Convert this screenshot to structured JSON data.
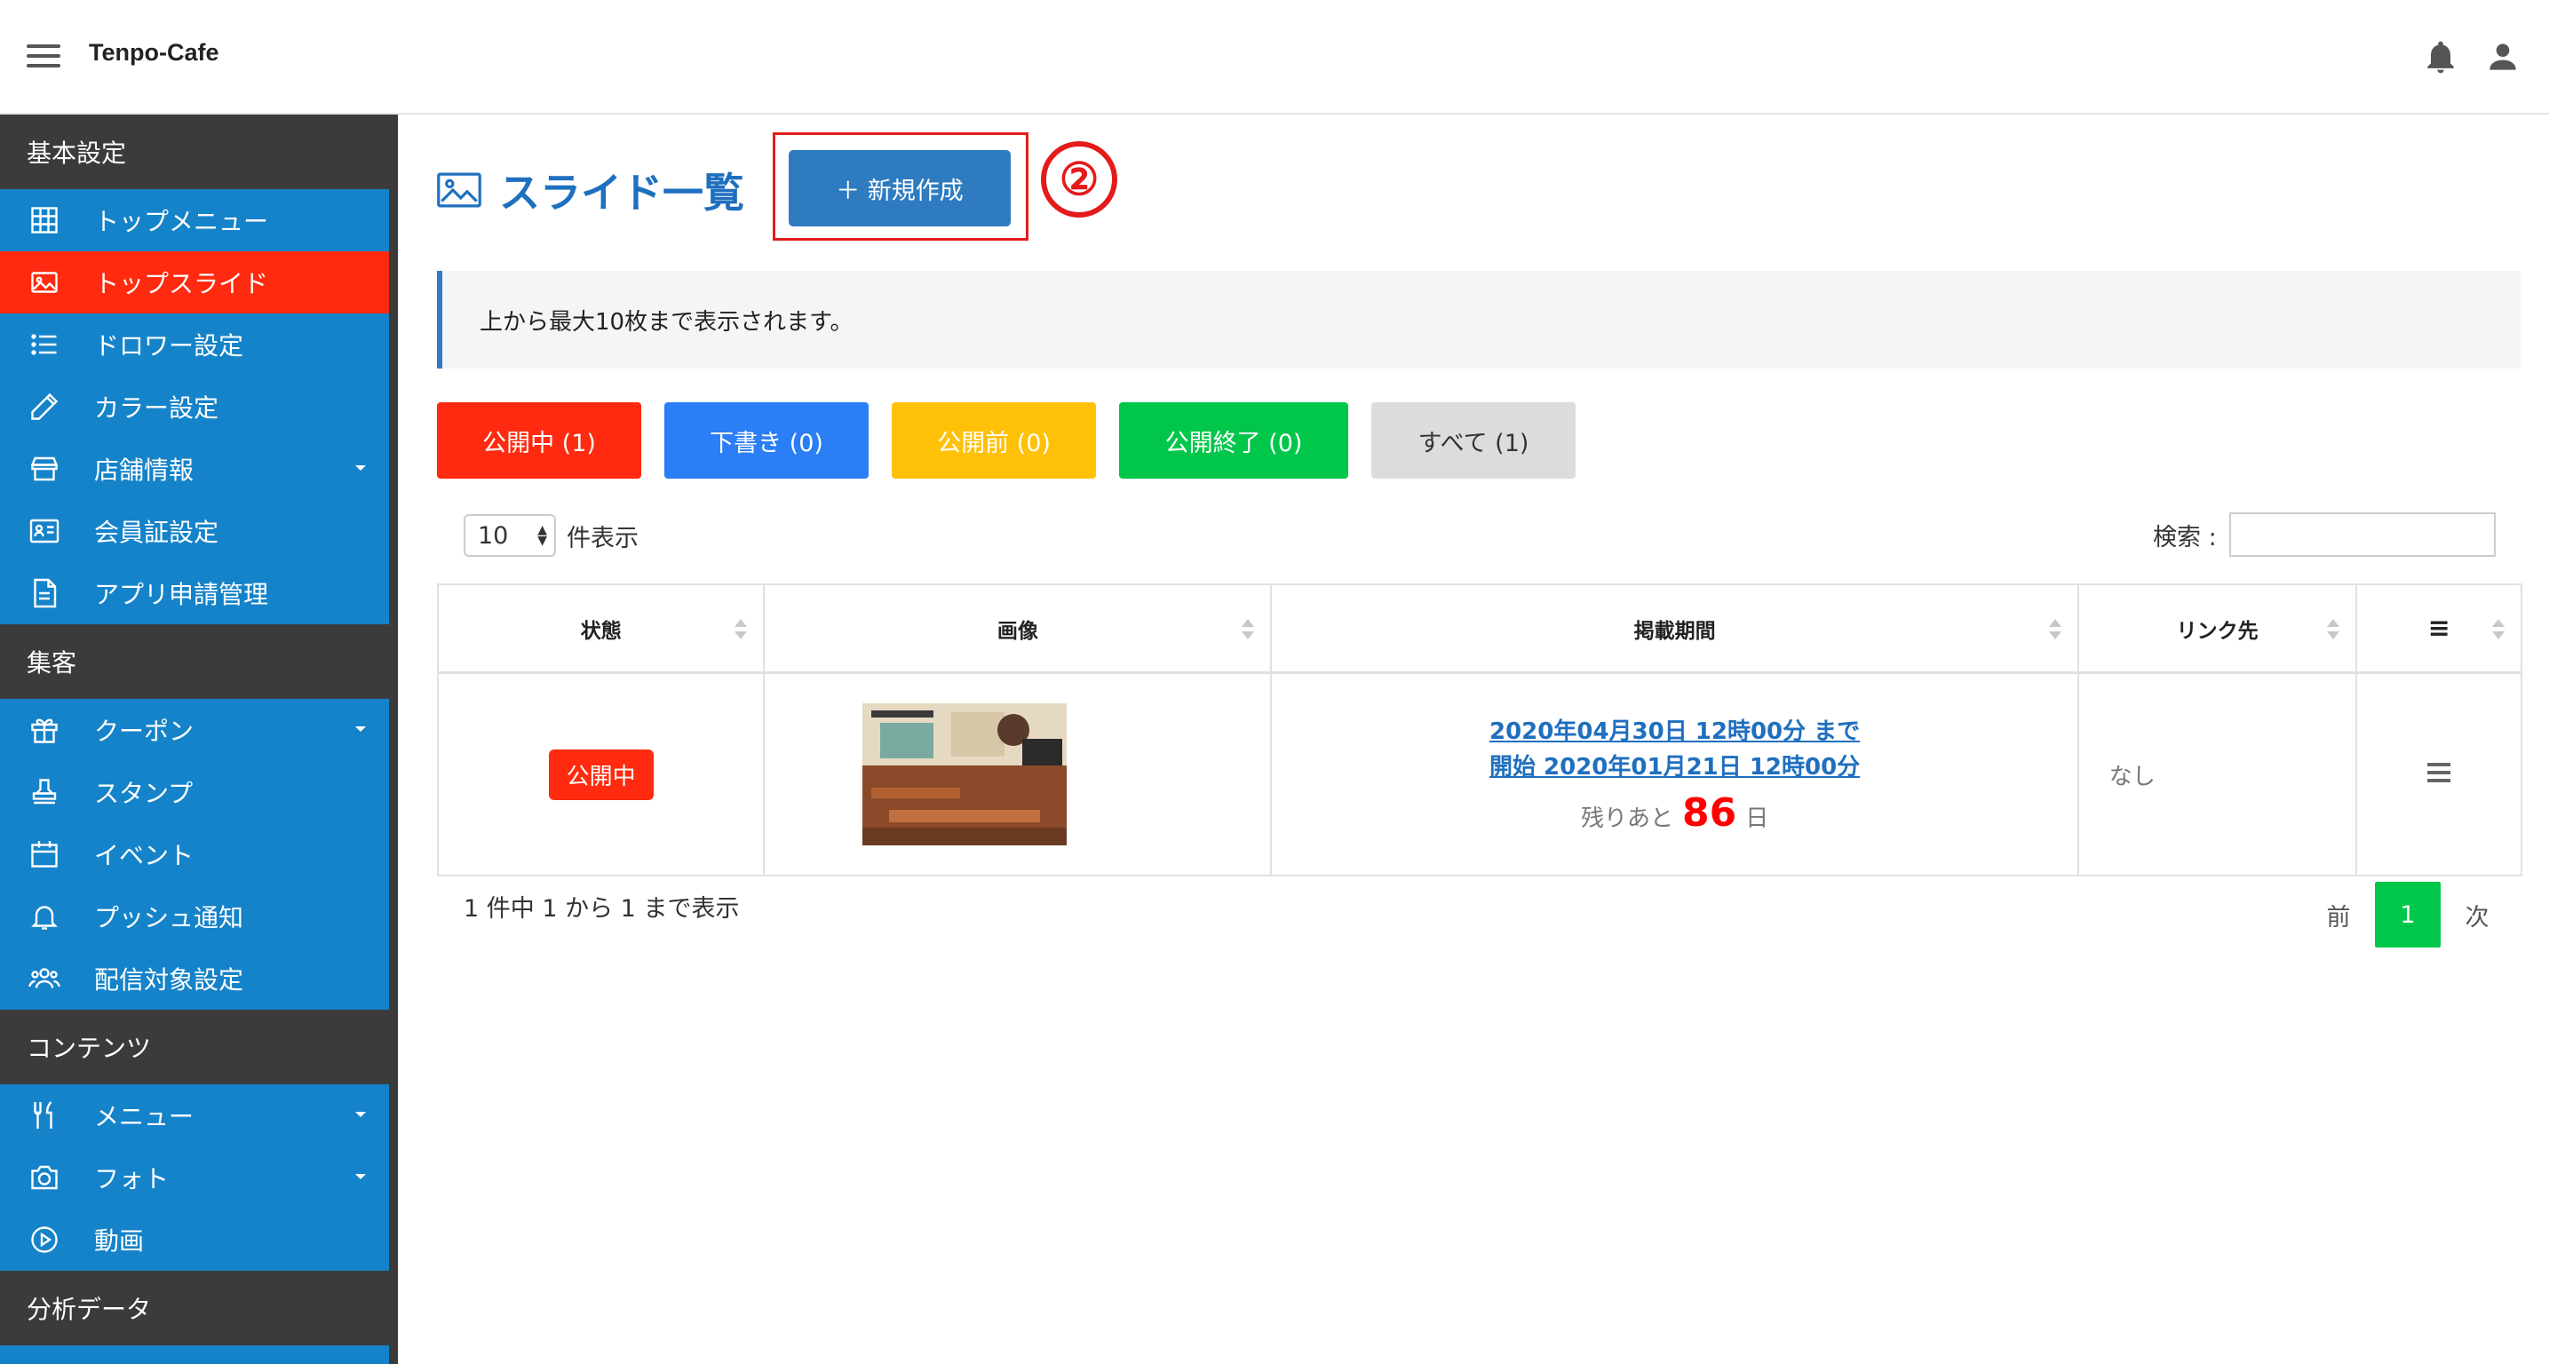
{
  "app": {
    "title": "Tenpo-Cafe"
  },
  "header_icons": [
    "bell-icon",
    "user-icon"
  ],
  "sidebar": {
    "sections": [
      {
        "label": "基本設定",
        "items": [
          {
            "label": "トップメニュー",
            "icon": "grid-icon",
            "active": false,
            "has_caret": false
          },
          {
            "label": "トップスライド",
            "icon": "image-icon",
            "active": true,
            "has_caret": false
          },
          {
            "label": "ドロワー設定",
            "icon": "list-icon",
            "active": false,
            "has_caret": false
          },
          {
            "label": "カラー設定",
            "icon": "pencil-icon",
            "active": false,
            "has_caret": false
          },
          {
            "label": "店舗情報",
            "icon": "store-icon",
            "active": false,
            "has_caret": true
          },
          {
            "label": "会員証設定",
            "icon": "id-card-icon",
            "active": false,
            "has_caret": false
          },
          {
            "label": "アプリ申請管理",
            "icon": "document-icon",
            "active": false,
            "has_caret": false
          }
        ]
      },
      {
        "label": "集客",
        "items": [
          {
            "label": "クーポン",
            "icon": "gift-icon",
            "active": false,
            "has_caret": true
          },
          {
            "label": "スタンプ",
            "icon": "stamp-icon",
            "active": false,
            "has_caret": false
          },
          {
            "label": "イベント",
            "icon": "calendar-icon",
            "active": false,
            "has_caret": false
          },
          {
            "label": "プッシュ通知",
            "icon": "bell-icon",
            "active": false,
            "has_caret": false
          },
          {
            "label": "配信対象設定",
            "icon": "users-icon",
            "active": false,
            "has_caret": false
          }
        ]
      },
      {
        "label": "コンテンツ",
        "items": [
          {
            "label": "メニュー",
            "icon": "utensils-icon",
            "active": false,
            "has_caret": true
          },
          {
            "label": "フォト",
            "icon": "camera-icon",
            "active": false,
            "has_caret": true
          },
          {
            "label": "動画",
            "icon": "play-icon",
            "active": false,
            "has_caret": false
          }
        ]
      },
      {
        "label": "分析データ",
        "items": []
      }
    ]
  },
  "page": {
    "title": "スライド一覧",
    "new_button": "＋ 新規作成",
    "annotation": "②",
    "notice": "上から最大10枚まで表示されます。"
  },
  "filters": [
    {
      "label": "公開中 (1)",
      "color": "#ff2a0f"
    },
    {
      "label": "下書き (0)",
      "color": "#2a7ef6"
    },
    {
      "label": "公開前 (0)",
      "color": "#ffc107"
    },
    {
      "label": "公開終了 (0)",
      "color": "#00c74a"
    },
    {
      "label": "すべて (1)",
      "color": "#dcdcdc"
    }
  ],
  "table_controls": {
    "page_length": "10",
    "page_length_suffix": "件表示",
    "search_label": "検索 :"
  },
  "table": {
    "headers": [
      "状態",
      "画像",
      "掲載期間",
      "リンク先",
      "≡"
    ],
    "rows": [
      {
        "status": "公開中",
        "period_end": "2020年04月30日 12時00分 まで",
        "period_start": "開始 2020年01月21日 12時00分",
        "remain_prefix": "残りあと",
        "remain_days": "86",
        "remain_suffix": "日",
        "link": "なし"
      }
    ]
  },
  "footer": {
    "info": "1 件中 1 から 1 まで表示",
    "prev": "前",
    "current_page": "1",
    "next": "次"
  }
}
